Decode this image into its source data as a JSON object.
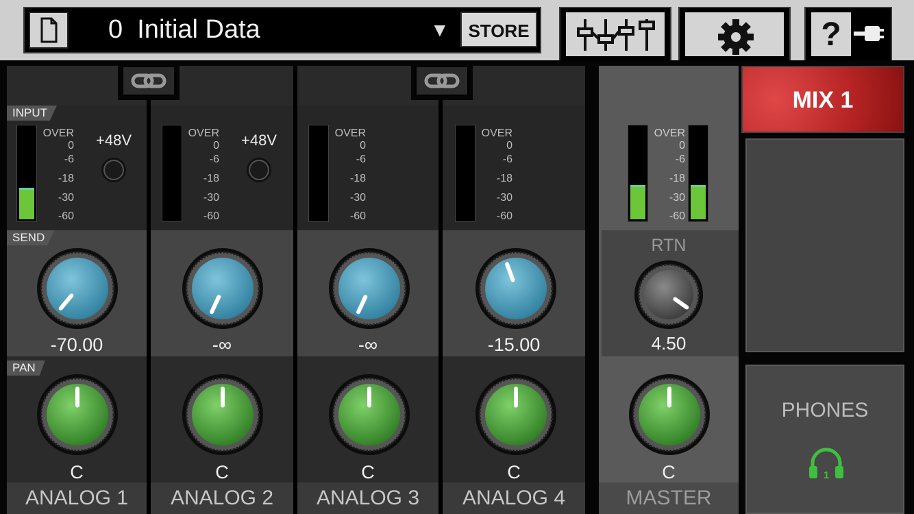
{
  "header": {
    "preset_name": "0  Initial Data",
    "store_label": "STORE"
  },
  "sections": {
    "input": "INPUT",
    "send": "SEND",
    "pan": "PAN",
    "rtn": "RTN"
  },
  "meter_scale": [
    "OVER",
    "0",
    "-6",
    "-18",
    "-30",
    "-60"
  ],
  "phantom_label": "+48V",
  "channels": [
    {
      "name": "ANALOG 1",
      "send": "-70.00",
      "pan": "C",
      "level": 0.32,
      "phantom": true
    },
    {
      "name": "ANALOG 2",
      "send": "-∞",
      "pan": "C",
      "level": 0,
      "phantom": true
    },
    {
      "name": "ANALOG 3",
      "send": "-∞",
      "pan": "C",
      "level": 0,
      "phantom": false
    },
    {
      "name": "ANALOG 4",
      "send": "-15.00",
      "pan": "C",
      "level": 0,
      "phantom": false
    }
  ],
  "master": {
    "name": "MASTER",
    "rtn": "4.50",
    "pan": "C",
    "level_l": 0.35,
    "level_r": 0.35
  },
  "mix": {
    "active_label": "MIX 1",
    "phones_label": "PHONES",
    "phones_number": "1"
  },
  "colors": {
    "accent_red": "#c62b2b",
    "send_knob": "#4a9ab8",
    "pan_knob": "#4ca33a",
    "meter_green": "#6cc63a",
    "phones_icon": "#3fbf3f"
  },
  "icons": [
    "document-icon",
    "dropdown-arrow-icon",
    "mixer-faders-icon",
    "gear-icon",
    "help-icon",
    "plug-icon",
    "link-icon",
    "headphones-icon"
  ]
}
